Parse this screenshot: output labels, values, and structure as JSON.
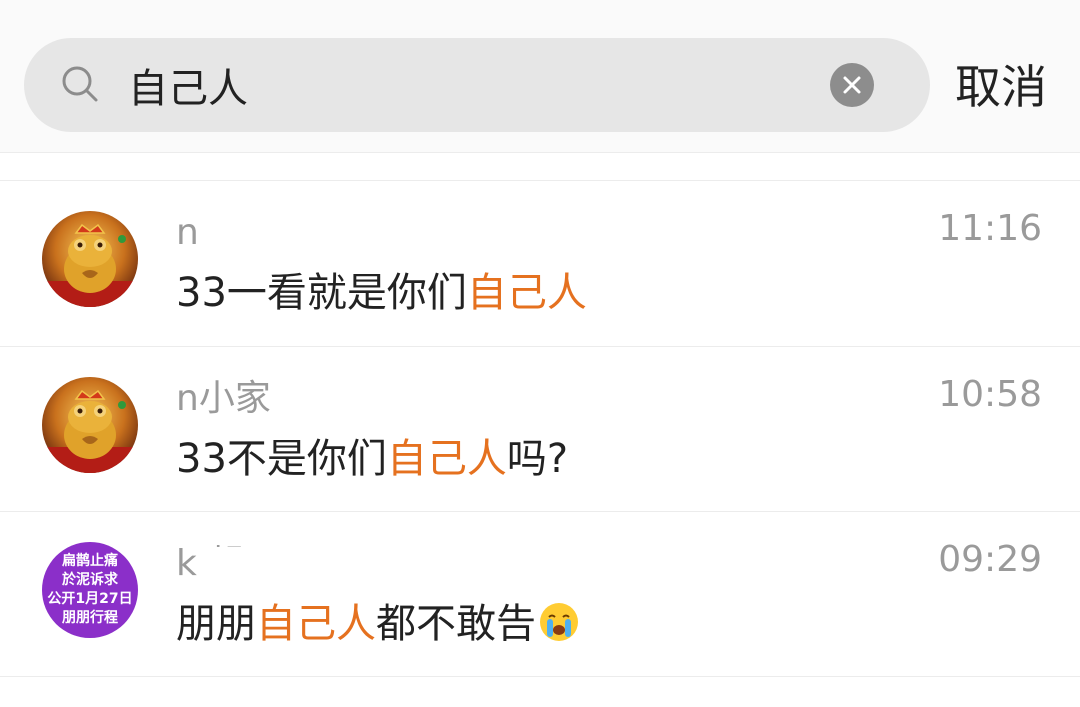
{
  "search": {
    "value": "自己人",
    "cancel_label": "取消"
  },
  "results": [
    {
      "name": "n",
      "time": "11:16",
      "msg_before": "33一看就是你们",
      "msg_highlight": "自己人",
      "msg_after": "",
      "avatar": "golden-frog",
      "emoji": ""
    },
    {
      "name": "n小家",
      "time": "10:58",
      "msg_before": "33不是你们",
      "msg_highlight": "自己人",
      "msg_after": "吗?",
      "avatar": "golden-frog",
      "emoji": ""
    },
    {
      "name": "k 起",
      "time": "09:29",
      "msg_before": "朋朋",
      "msg_highlight": "自己人",
      "msg_after": "都不敢告",
      "avatar": "purple-text-badge",
      "avatar_text": [
        "扁鹊止痛",
        "於泥诉求",
        "公开1月27日",
        "朋朋行程"
      ],
      "emoji": "crying-face"
    }
  ],
  "colors": {
    "highlight": "#e5711f",
    "search_bg": "#e6e6e6",
    "avatar_purple": "#8b2fc9"
  }
}
